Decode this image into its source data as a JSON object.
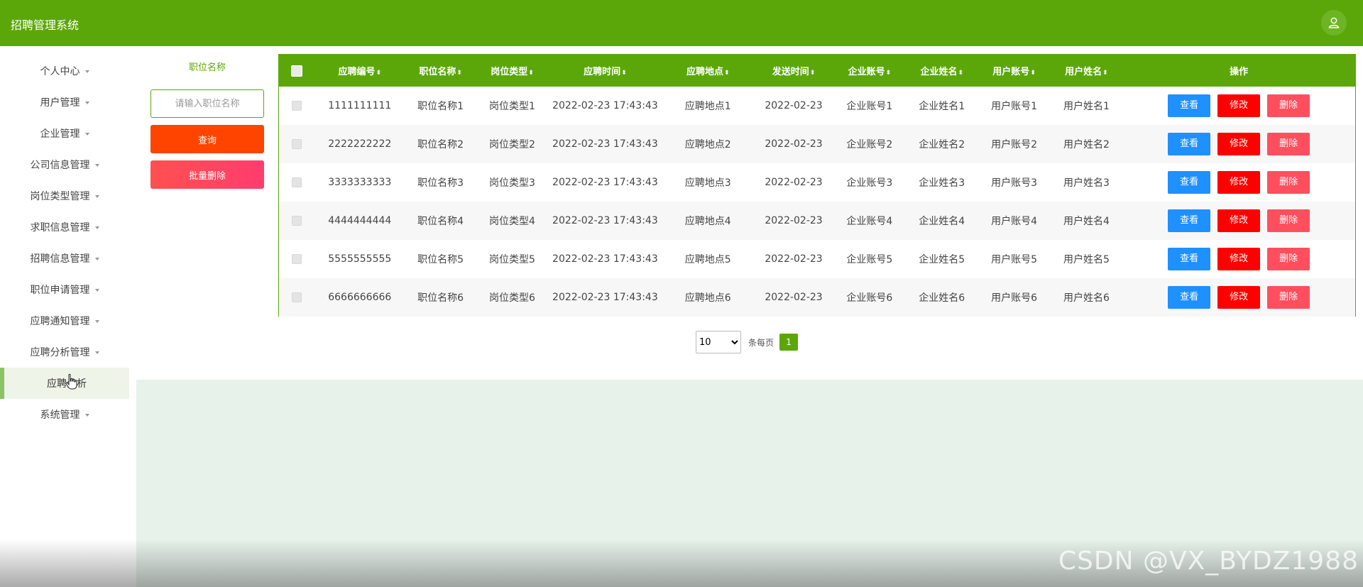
{
  "app": {
    "title": "招聘管理系统"
  },
  "sidebar": {
    "items": [
      {
        "label": "个人中心"
      },
      {
        "label": "用户管理"
      },
      {
        "label": "企业管理"
      },
      {
        "label": "公司信息管理"
      },
      {
        "label": "岗位类型管理"
      },
      {
        "label": "求职信息管理"
      },
      {
        "label": "招聘信息管理"
      },
      {
        "label": "职位申请管理"
      },
      {
        "label": "应聘通知管理"
      },
      {
        "label": "应聘分析管理"
      }
    ],
    "active_sub": {
      "label": "应聘分析"
    },
    "last": {
      "label": "系统管理"
    }
  },
  "search": {
    "label": "职位名称",
    "placeholder": "请输入职位名称",
    "query_label": "查询",
    "batch_delete_label": "批量删除"
  },
  "table": {
    "headers": [
      "应聘编号",
      "职位名称",
      "岗位类型",
      "应聘时间",
      "应聘地点",
      "发送时间",
      "企业账号",
      "企业姓名",
      "用户账号",
      "用户姓名",
      "操作"
    ],
    "sort_glyph": "⬍",
    "actions": {
      "view": "查看",
      "edit": "修改",
      "delete": "删除"
    },
    "rows": [
      [
        "1111111111",
        "职位名称1",
        "岗位类型1",
        "2022-02-23 17:43:43",
        "应聘地点1",
        "2022-02-23",
        "企业账号1",
        "企业姓名1",
        "用户账号1",
        "用户姓名1"
      ],
      [
        "2222222222",
        "职位名称2",
        "岗位类型2",
        "2022-02-23 17:43:43",
        "应聘地点2",
        "2022-02-23",
        "企业账号2",
        "企业姓名2",
        "用户账号2",
        "用户姓名2"
      ],
      [
        "3333333333",
        "职位名称3",
        "岗位类型3",
        "2022-02-23 17:43:43",
        "应聘地点3",
        "2022-02-23",
        "企业账号3",
        "企业姓名3",
        "用户账号3",
        "用户姓名3"
      ],
      [
        "4444444444",
        "职位名称4",
        "岗位类型4",
        "2022-02-23 17:43:43",
        "应聘地点4",
        "2022-02-23",
        "企业账号4",
        "企业姓名4",
        "用户账号4",
        "用户姓名4"
      ],
      [
        "5555555555",
        "职位名称5",
        "岗位类型5",
        "2022-02-23 17:43:43",
        "应聘地点5",
        "2022-02-23",
        "企业账号5",
        "企业姓名5",
        "用户账号5",
        "用户姓名5"
      ],
      [
        "6666666666",
        "职位名称6",
        "岗位类型6",
        "2022-02-23 17:43:43",
        "应聘地点6",
        "2022-02-23",
        "企业账号6",
        "企业姓名6",
        "用户账号6",
        "用户姓名6"
      ]
    ]
  },
  "pager": {
    "page_size": "10",
    "per_page_label": "条每页",
    "current_page": "1"
  },
  "watermark": "CSDN @VX_BYDZ1988",
  "colors": {
    "primary": "#5ba70a",
    "query": "#ff4400",
    "view": "#1e90ff",
    "edit": "#ff0000",
    "delete": "#ff4f5e"
  },
  "icons": {
    "avatar": "user-icon",
    "caret": "caret-down-icon",
    "cursor": "hand-pointer-icon"
  }
}
